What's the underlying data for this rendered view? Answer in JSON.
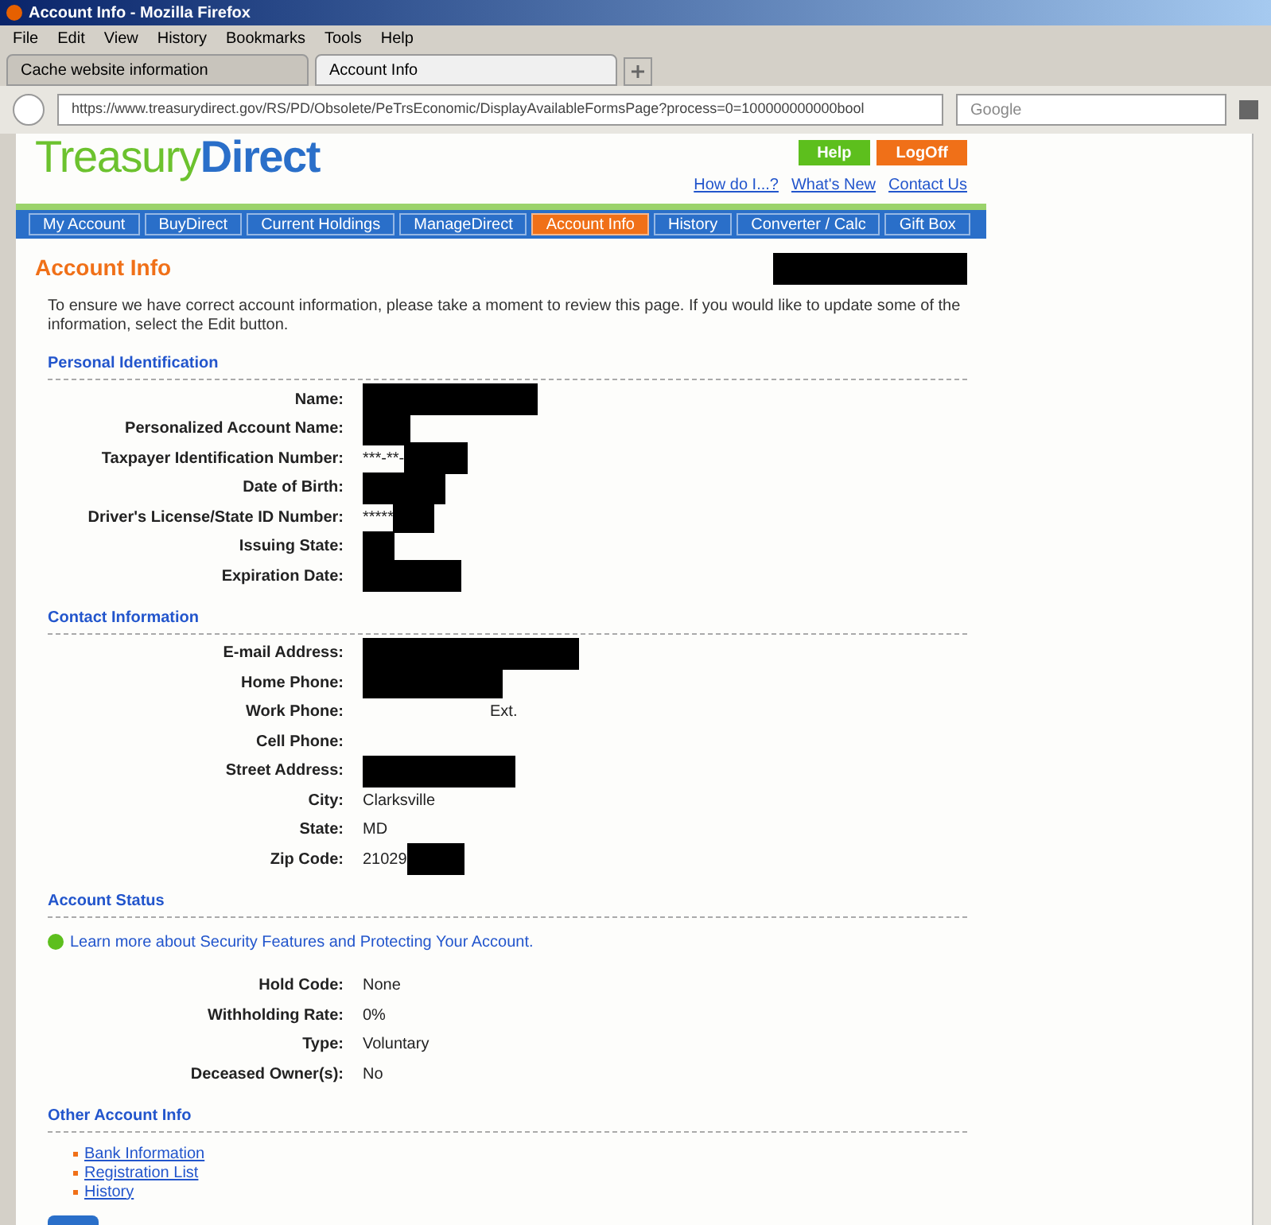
{
  "window": {
    "title": "Account Info - Mozilla Firefox"
  },
  "menu": [
    "File",
    "Edit",
    "View",
    "History",
    "Bookmarks",
    "Tools",
    "Help"
  ],
  "browser_tabs": [
    {
      "label": "Cache website information",
      "selected": false
    },
    {
      "label": "Account Info",
      "selected": true
    }
  ],
  "address_bar": {
    "url": "https://www.treasurydirect.gov/RS/PD/Obsolete/PeTrsEconomic/DisplayAvailableFormsPage?process=0=100000000000bool"
  },
  "search": {
    "placeholder": "Google"
  },
  "site": {
    "logo_left": "Treasury",
    "logo_right": "Direct",
    "buttons": [
      "Help",
      "LogOff"
    ],
    "links": [
      "How do I...?",
      "What's New",
      "Contact Us"
    ]
  },
  "nav_tabs": [
    {
      "label": "My Account",
      "selected": false
    },
    {
      "label": "BuyDirect",
      "selected": false
    },
    {
      "label": "Current Holdings",
      "selected": false
    },
    {
      "label": "ManageDirect",
      "selected": false
    },
    {
      "label": "Account Info",
      "selected": true
    },
    {
      "label": "History",
      "selected": false
    },
    {
      "label": "Converter / Calc",
      "selected": false
    },
    {
      "label": "Gift Box",
      "selected": false
    }
  ],
  "page_title": "Account Info",
  "intro": "To ensure we have correct account information, please take a moment to review this page. If you would like to update some of the information, select the Edit button.",
  "sections": [
    {
      "title": "Personal Identification",
      "rows": [
        {
          "label": "Name:",
          "kind": "redacted"
        },
        {
          "label": "Personalized Account Name:",
          "kind": "redacted"
        },
        {
          "label": "Taxpayer Identification Number:",
          "kind": "masked",
          "value": "***-**-"
        },
        {
          "label": "Date of Birth:",
          "kind": "redacted"
        },
        {
          "label": "Driver's License/State ID Number:",
          "kind": "masked",
          "value": "*****"
        },
        {
          "label": "Issuing State:",
          "kind": "redacted"
        },
        {
          "label": "Expiration Date:",
          "kind": "redacted"
        }
      ]
    },
    {
      "title": "Contact Information",
      "rows": [
        {
          "label": "E-mail Address:",
          "kind": "redacted"
        },
        {
          "label": "Home Phone:",
          "kind": "redacted"
        },
        {
          "label": "Work Phone:",
          "kind": "ext",
          "value": "Ext."
        },
        {
          "label": "Cell Phone:",
          "kind": "empty"
        },
        {
          "label": "Street Address:",
          "kind": "redacted"
        },
        {
          "label": "City:",
          "kind": "text",
          "value": "Clarksville"
        },
        {
          "label": "State:",
          "kind": "text",
          "value": "MD"
        },
        {
          "label": "Zip Code:",
          "kind": "masked",
          "value": "21029"
        }
      ]
    },
    {
      "title": "Account Status",
      "link": "Learn more about Security Features and Protecting Your Account.",
      "rows": [
        {
          "label": "Hold Code:",
          "kind": "text",
          "value": "None"
        },
        {
          "label": "Withholding Rate:",
          "kind": "text",
          "value": "0%"
        },
        {
          "label": "Type:",
          "kind": "text",
          "value": "Voluntary"
        },
        {
          "label": "Deceased Owner(s):",
          "kind": "text",
          "value": "No"
        }
      ]
    },
    {
      "title": "Other Account Info",
      "links": [
        "Bank Information",
        "Registration List",
        "History"
      ]
    }
  ]
}
